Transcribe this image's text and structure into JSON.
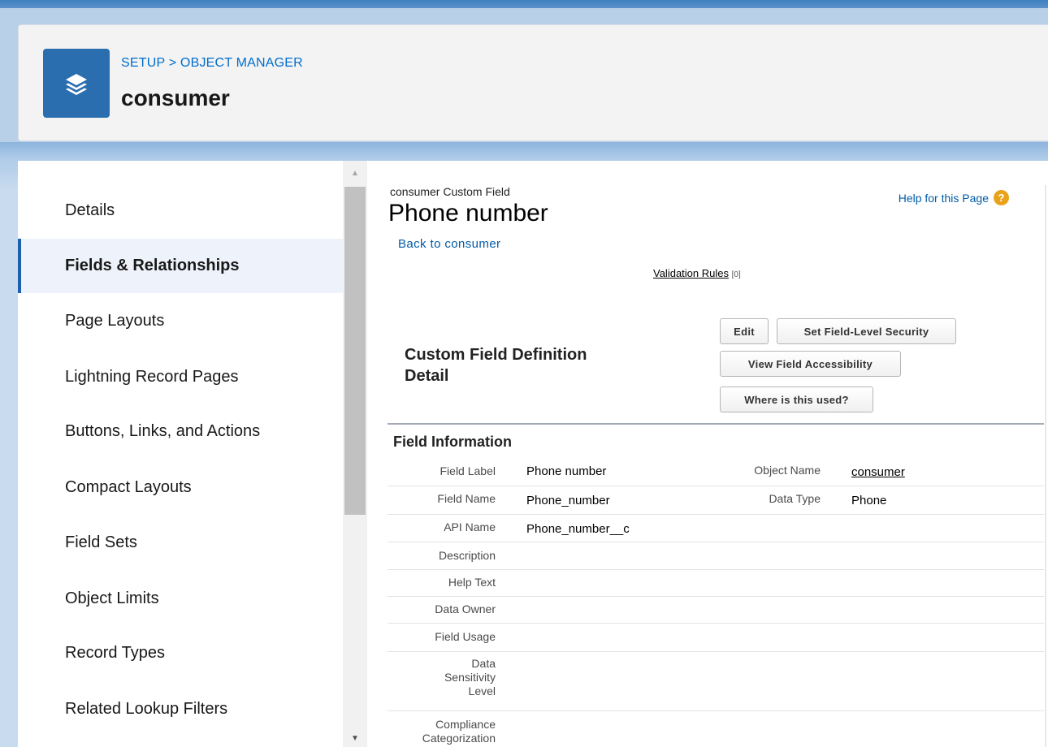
{
  "header": {
    "breadcrumb_setup": "SETUP",
    "breadcrumb_sep": ">",
    "breadcrumb_object_manager": "OBJECT MANAGER",
    "object_title": "consumer",
    "icon": "layers-icon"
  },
  "sidebar": {
    "items": [
      {
        "label": "Details"
      },
      {
        "label": "Fields & Relationships",
        "active": true
      },
      {
        "label": "Page Layouts"
      },
      {
        "label": "Lightning Record Pages"
      },
      {
        "label": "Buttons, Links, and Actions"
      },
      {
        "label": "Compact Layouts"
      },
      {
        "label": "Field Sets"
      },
      {
        "label": "Object Limits"
      },
      {
        "label": "Record Types"
      },
      {
        "label": "Related Lookup Filters"
      }
    ]
  },
  "content": {
    "subtitle": "consumer Custom Field",
    "title": "Phone number",
    "back_link": "Back to consumer",
    "help_link": "Help for this Page",
    "validation_rules_link": "Validation Rules",
    "validation_rules_count": "[0]",
    "section_title_line1": "Custom Field Definition",
    "section_title_line2": "Detail",
    "buttons": {
      "edit": "Edit",
      "set_fls": "Set Field-Level Security",
      "view_access": "View Field Accessibility",
      "where_used": "Where is this used?"
    },
    "field_info_title": "Field Information",
    "fields": {
      "field_label_lbl": "Field Label",
      "field_label_val": "Phone number",
      "object_name_lbl": "Object Name",
      "object_name_val": "consumer",
      "field_name_lbl": "Field Name",
      "field_name_val": "Phone_number",
      "data_type_lbl": "Data Type",
      "data_type_val": "Phone",
      "api_name_lbl": "API Name",
      "api_name_val": "Phone_number__c",
      "description_lbl": "Description",
      "help_text_lbl": "Help Text",
      "data_owner_lbl": "Data Owner",
      "field_usage_lbl": "Field Usage",
      "data_sensitivity_lbl_1": "Data",
      "data_sensitivity_lbl_2": "Sensitivity",
      "data_sensitivity_lbl_3": "Level",
      "compliance_lbl_1": "Compliance",
      "compliance_lbl_2": "Categorization"
    }
  },
  "colors": {
    "brand_blue": "#2b6eaf",
    "link_blue": "#015ba7",
    "help_orange": "#e8a31a"
  }
}
